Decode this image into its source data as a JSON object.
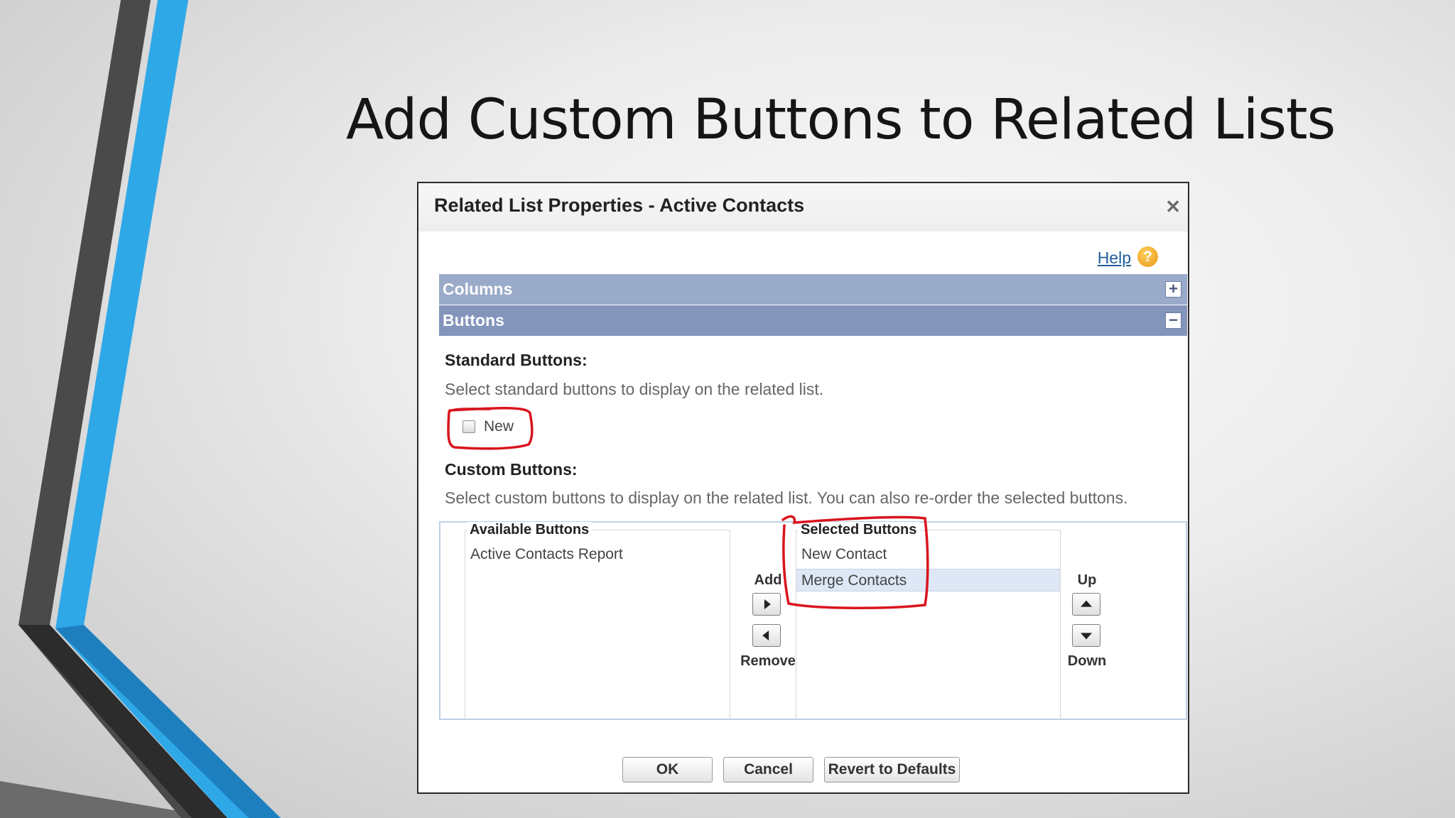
{
  "slide": {
    "title": "Add Custom Buttons to Related Lists"
  },
  "dialog": {
    "title": "Related List Properties - Active Contacts",
    "close_icon": "close-icon",
    "help_label": "Help",
    "help_icon": "question-icon",
    "help_icon_glyph": "?"
  },
  "sections": {
    "columns": {
      "label": "Columns",
      "toggle_glyph": "+"
    },
    "buttons": {
      "label": "Buttons",
      "toggle_glyph": "−"
    }
  },
  "standard_buttons": {
    "heading": "Standard Buttons:",
    "description": "Select standard buttons to display on the related list.",
    "options": [
      {
        "label": "New",
        "checked": false
      }
    ]
  },
  "custom_buttons": {
    "heading": "Custom Buttons:",
    "description": "Select custom buttons to display on the related list. You can also re-order the selected buttons.",
    "available": {
      "legend": "Available Buttons",
      "items": [
        "Active Contacts Report"
      ]
    },
    "selected": {
      "legend": "Selected Buttons",
      "items": [
        "New Contact",
        "Merge Contacts"
      ],
      "selected_index": 1
    },
    "controls": {
      "add_label": "Add",
      "remove_label": "Remove",
      "up_label": "Up",
      "down_label": "Down"
    }
  },
  "footer": {
    "ok_label": "OK",
    "cancel_label": "Cancel",
    "revert_label": "Revert to Defaults"
  },
  "colors": {
    "accent_blue": "#2fa8e8",
    "section_bar": "#8395bb",
    "annotation_red": "#d9141e"
  }
}
